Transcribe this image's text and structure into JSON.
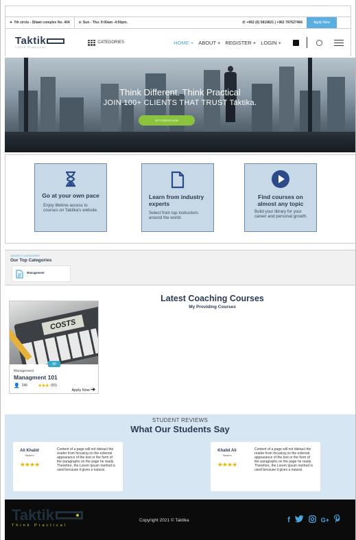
{
  "topbar": {
    "address": "7th circle - Silawi complex No. 404",
    "hours": "Sun - Thu: 9:00am -4:00pm.",
    "phone": "+962 (6) 5819821 | +962 797627466",
    "apply_label": "Apply Now"
  },
  "nav": {
    "logo_text": "Taktik",
    "logo_tagline": "Think Practical",
    "categories_label": "CATEGORIES",
    "items": [
      {
        "label": "HOME +"
      },
      {
        "label": "ABOUT +"
      },
      {
        "label": "REGISTER +"
      },
      {
        "label": "LOGIN +"
      }
    ]
  },
  "hero": {
    "line1": "Think Different. Think Practical",
    "line2": "JOIN 100+ CLIENTS THAT TRUST Taktika.",
    "button_label": "GET STARTED NOW"
  },
  "features": [
    {
      "title": "Go at your own pace",
      "desc": "Enjoy lifetime access to courses on Taktika's website.",
      "icon": "hourglass-icon"
    },
    {
      "title": "Learn from industry experts",
      "desc": "Select from top instructors around the world.",
      "icon": "document-icon"
    },
    {
      "title": "Find courses on almost any topic",
      "desc": "Build your library for your career and personal growth.",
      "icon": "play-icon"
    }
  ],
  "top_categories": {
    "subtitle": "SUBJECT CATEGORIES",
    "title": "Our Top Categories",
    "items": [
      {
        "name": "Management",
        "count": "1"
      }
    ]
  },
  "courses": {
    "title": "Latest Coaching Courses",
    "subtitle": "My Providing Courses",
    "items": [
      {
        "category": "Management",
        "name": "Managment 101",
        "price": "90",
        "students": "245",
        "rating_count": "(65)",
        "apply_label": "Apply Now",
        "image_text": "COSTS"
      }
    ]
  },
  "reviews": {
    "kicker": "STUDENT REVIEWS",
    "title": "What Our Students Say",
    "items": [
      {
        "name": "Ali Khalid",
        "role": "Student",
        "text": "Content of a page will not distract the reader from focusing on the external appearance of the text or the form of the paragraphs on the page he reads. Therefore, the Lorem Ipsum method is used because it gives a natural.",
        "stars": 4
      },
      {
        "name": "Khalid Ali",
        "role": "Student",
        "text": "Content of a page will not distract the reader from focusing on the external appearance of the text or the form of the paragraphs on the page he reads. Therefore, the Lorem Ipsum method is used because it gives a natural.",
        "stars": 4
      }
    ]
  },
  "footer": {
    "logo_text": "Taktik",
    "logo_tagline": "Think Practical",
    "copyright": "Copyright 2021 © Taktika",
    "social": [
      "facebook-icon",
      "twitter-icon",
      "instagram-icon",
      "google-plus-icon",
      "pinterest-icon"
    ]
  },
  "colors": {
    "accent": "#4aa6dc",
    "navy": "#2c3a52",
    "cta_green": "#8ac43f",
    "card_bg": "#c7d8e6",
    "reviews_bg": "#d6e6f3",
    "star": "#e9b400"
  }
}
